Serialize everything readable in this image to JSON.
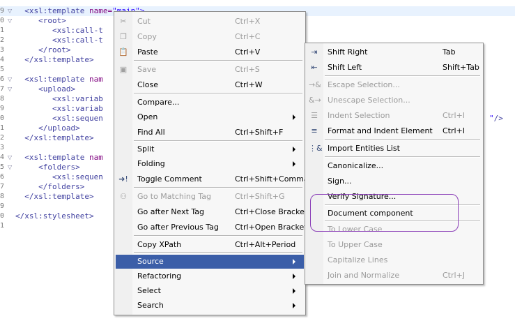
{
  "editor": {
    "line_numbers": [
      "9",
      "0",
      "1",
      "2",
      "3",
      "4",
      "5",
      "6",
      "7",
      "8",
      "9",
      "0",
      "1",
      "2",
      "3",
      "4",
      "5",
      "6",
      "7",
      "8",
      "9",
      "0",
      "1"
    ],
    "lines": [
      {
        "indent": "  ",
        "tag": "<xsl:template ",
        "attr": "name=",
        "str": "\"main\">"
      },
      {
        "indent": "     ",
        "tag": "<root>",
        "attr": "",
        "str": ""
      },
      {
        "indent": "        ",
        "tag": "<xsl:call-t",
        "attr": "",
        "str": ""
      },
      {
        "indent": "        ",
        "tag": "<xsl:call-t",
        "attr": "",
        "str": ""
      },
      {
        "indent": "     ",
        "tag": "</root>",
        "attr": "",
        "str": ""
      },
      {
        "indent": "  ",
        "tag": "</xsl:template>",
        "attr": "",
        "str": ""
      },
      {
        "indent": "",
        "tag": "",
        "attr": "",
        "str": ""
      },
      {
        "indent": "  ",
        "tag": "<xsl:template ",
        "attr": "nam",
        "str": ""
      },
      {
        "indent": "     ",
        "tag": "<upload>",
        "attr": "",
        "str": ""
      },
      {
        "indent": "        ",
        "tag": "<xsl:variab",
        "attr": "",
        "str": ""
      },
      {
        "indent": "        ",
        "tag": "<xsl:variab",
        "attr": "",
        "str": ""
      },
      {
        "indent": "        ",
        "tag": "<xsl:sequen",
        "attr": "",
        "str": ""
      },
      {
        "indent": "     ",
        "tag": "</upload>",
        "attr": "",
        "str": ""
      },
      {
        "indent": "  ",
        "tag": "</xsl:template>",
        "attr": "",
        "str": ""
      },
      {
        "indent": "",
        "tag": "",
        "attr": "",
        "str": ""
      },
      {
        "indent": "  ",
        "tag": "<xsl:template ",
        "attr": "nam",
        "str": ""
      },
      {
        "indent": "     ",
        "tag": "<folders>",
        "attr": "",
        "str": ""
      },
      {
        "indent": "        ",
        "tag": "<xsl:sequen",
        "attr": "",
        "str": ""
      },
      {
        "indent": "     ",
        "tag": "</folders>",
        "attr": "",
        "str": ""
      },
      {
        "indent": "  ",
        "tag": "</xsl:template>",
        "attr": "",
        "str": ""
      },
      {
        "indent": "",
        "tag": "",
        "attr": "",
        "str": ""
      },
      {
        "indent": "",
        "tag": "</xsl:stylesheet>",
        "attr": "",
        "str": ""
      },
      {
        "indent": "",
        "tag": "",
        "attr": "",
        "str": ""
      }
    ],
    "line9_tail_quote": "\"",
    "line9_tail_end": "/>"
  },
  "context_menu": {
    "items": [
      {
        "label": "Cut",
        "accel": "Ctrl+X",
        "disabled": true,
        "icon": "scissors-icon",
        "glyph": "✂"
      },
      {
        "label": "Copy",
        "accel": "Ctrl+C",
        "disabled": true,
        "icon": "copy-icon",
        "glyph": "❐"
      },
      {
        "label": "Paste",
        "accel": "Ctrl+V",
        "disabled": false,
        "icon": "paste-icon",
        "glyph": "📋"
      },
      {
        "label": "Save",
        "accel": "Ctrl+S",
        "disabled": true,
        "icon": "save-icon",
        "glyph": "▣"
      },
      {
        "label": "Close",
        "accel": "Ctrl+W",
        "disabled": false
      },
      {
        "label": "Compare...",
        "accel": "",
        "disabled": false
      },
      {
        "label": "Open",
        "accel": "",
        "disabled": false,
        "submenu": true
      },
      {
        "label": "Find All",
        "accel": "Ctrl+Shift+F",
        "disabled": false
      },
      {
        "label": "Split",
        "accel": "",
        "disabled": false,
        "submenu": true
      },
      {
        "label": "Folding",
        "accel": "",
        "disabled": false,
        "submenu": true
      },
      {
        "label": "Toggle Comment",
        "accel": "Ctrl+Shift+Comma",
        "disabled": false,
        "icon": "toggle-comment-icon",
        "glyph": "➜!"
      },
      {
        "label": "Go to Matching Tag",
        "accel": "Ctrl+Shift+G",
        "disabled": true,
        "icon": "matching-tag-icon",
        "glyph": "⚇"
      },
      {
        "label": "Go after Next Tag",
        "accel": "Ctrl+Close Bracket",
        "disabled": false
      },
      {
        "label": "Go after Previous Tag",
        "accel": "Ctrl+Open Bracket",
        "disabled": false
      },
      {
        "label": "Copy XPath",
        "accel": "Ctrl+Alt+Period",
        "disabled": false
      },
      {
        "label": "Source",
        "accel": "",
        "disabled": false,
        "submenu": true,
        "selected": true
      },
      {
        "label": "Refactoring",
        "accel": "",
        "disabled": false,
        "submenu": true
      },
      {
        "label": "Select",
        "accel": "",
        "disabled": false,
        "submenu": true
      },
      {
        "label": "Search",
        "accel": "",
        "disabled": false,
        "submenu": true
      }
    ]
  },
  "source_submenu": {
    "items": [
      {
        "label": "Shift Right",
        "accel": "Tab",
        "disabled": false,
        "icon": "shift-right-icon",
        "glyph": "⇥"
      },
      {
        "label": "Shift Left",
        "accel": "Shift+Tab",
        "disabled": false,
        "icon": "shift-left-icon",
        "glyph": "⇤"
      },
      {
        "label": "Escape Selection...",
        "accel": "",
        "disabled": true,
        "icon": "escape-icon",
        "glyph": "→&"
      },
      {
        "label": "Unescape Selection...",
        "accel": "",
        "disabled": true,
        "icon": "unescape-icon",
        "glyph": "&→"
      },
      {
        "label": "Indent Selection",
        "accel": "Ctrl+I",
        "disabled": true,
        "icon": "indent-icon",
        "glyph": "☰"
      },
      {
        "label": "Format and Indent Element",
        "accel": "Ctrl+I",
        "disabled": false,
        "icon": "format-icon",
        "glyph": "≡"
      },
      {
        "label": "Import Entities List",
        "accel": "",
        "disabled": false,
        "icon": "import-entities-icon",
        "glyph": "⋮&"
      },
      {
        "label": "Canonicalize...",
        "accel": "",
        "disabled": false
      },
      {
        "label": "Sign...",
        "accel": "",
        "disabled": false
      },
      {
        "label": "Verify Signature...",
        "accel": "",
        "disabled": false
      },
      {
        "label": "Document component",
        "accel": "",
        "disabled": false
      },
      {
        "label": "To Lower Case",
        "accel": "",
        "disabled": true
      },
      {
        "label": "To Upper Case",
        "accel": "",
        "disabled": true
      },
      {
        "label": "Capitalize Lines",
        "accel": "",
        "disabled": true
      },
      {
        "label": "Join and Normalize",
        "accel": "Ctrl+J",
        "disabled": true
      }
    ]
  },
  "colors": {
    "highlight": "#3b5ea8",
    "annotation": "#8b3fb8",
    "tag": "#3f3f9f",
    "string": "#2a00ff"
  }
}
